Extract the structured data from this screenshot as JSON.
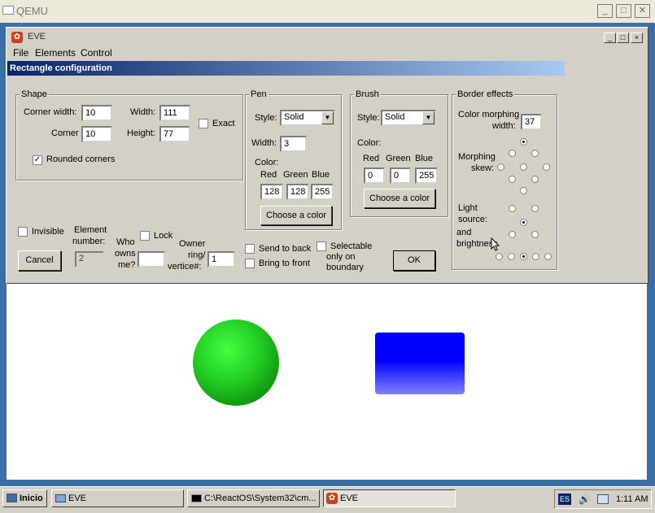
{
  "qemu": {
    "title": "QEMU"
  },
  "eve": {
    "title": "EVE",
    "menu": [
      "File",
      "Elements",
      "Control"
    ]
  },
  "dialog": {
    "title": "Rectangle configuration",
    "shape": {
      "label": "Shape",
      "corner_width_label": "Corner width:",
      "corner_width": "10",
      "corner_label": "Corner",
      "corner": "10",
      "width_label": "Width:",
      "width": "111",
      "height_label": "Height:",
      "height": "77",
      "exact_label": "Exact",
      "exact_checked": false,
      "rounded_label": "Rounded corners",
      "rounded_checked": true
    },
    "pen": {
      "label": "Pen",
      "style_label": "Style:",
      "style": "Solid",
      "width_label": "Width:",
      "width": "3",
      "color_label": "Color:",
      "red_label": "Red",
      "green_label": "Green",
      "blue_label": "Blue",
      "red": "128",
      "green": "128",
      "blue": "255",
      "choose_label": "Choose a color"
    },
    "brush": {
      "label": "Brush",
      "style_label": "Style:",
      "style": "Solid",
      "color_label": "Color:",
      "red_label": "Red",
      "green_label": "Green",
      "blue_label": "Blue",
      "red": "0",
      "green": "0",
      "blue": "255",
      "choose_label": "Choose a color"
    },
    "border": {
      "label": "Border effects",
      "morph_width_label_1": "Color morphing",
      "morph_width_label_2": "width:",
      "morph_width": "37",
      "skew_label_1": "Morphing",
      "skew_label_2": "skew:",
      "light_label_1": "Light",
      "light_label_2": "source:",
      "bright_label_1": "and",
      "bright_label_2": "brightness"
    },
    "bottom": {
      "invisible_label": "Invisible",
      "element_number_label_1": "Element",
      "element_number_label_2": "number:",
      "element_number": "2",
      "lock_label": "Lock",
      "who_owns_1": "Who",
      "who_owns_2": "owns",
      "who_owns_3": "me?",
      "who_owns_value": "",
      "owner_ring_1": "Owner",
      "owner_ring_2": "ring/",
      "owner_ring_3": "vertice#:",
      "owner_ring_value": "1",
      "send_back_label": "Send to back",
      "bring_front_label": "Bring to front",
      "selectable_1": "Selectable",
      "selectable_2": "only on",
      "selectable_3": "boundary",
      "cancel_label": "Cancel",
      "ok_label": "OK"
    }
  },
  "canvas": {
    "circle_color": "#22cc22",
    "rect_color": "#0000ff"
  },
  "taskbar": {
    "start_label": "Inicio",
    "items": [
      "EVE",
      "C:\\ReactOS\\System32\\cm...",
      "EVE"
    ],
    "lang": "ES",
    "time": "1:11 AM"
  }
}
